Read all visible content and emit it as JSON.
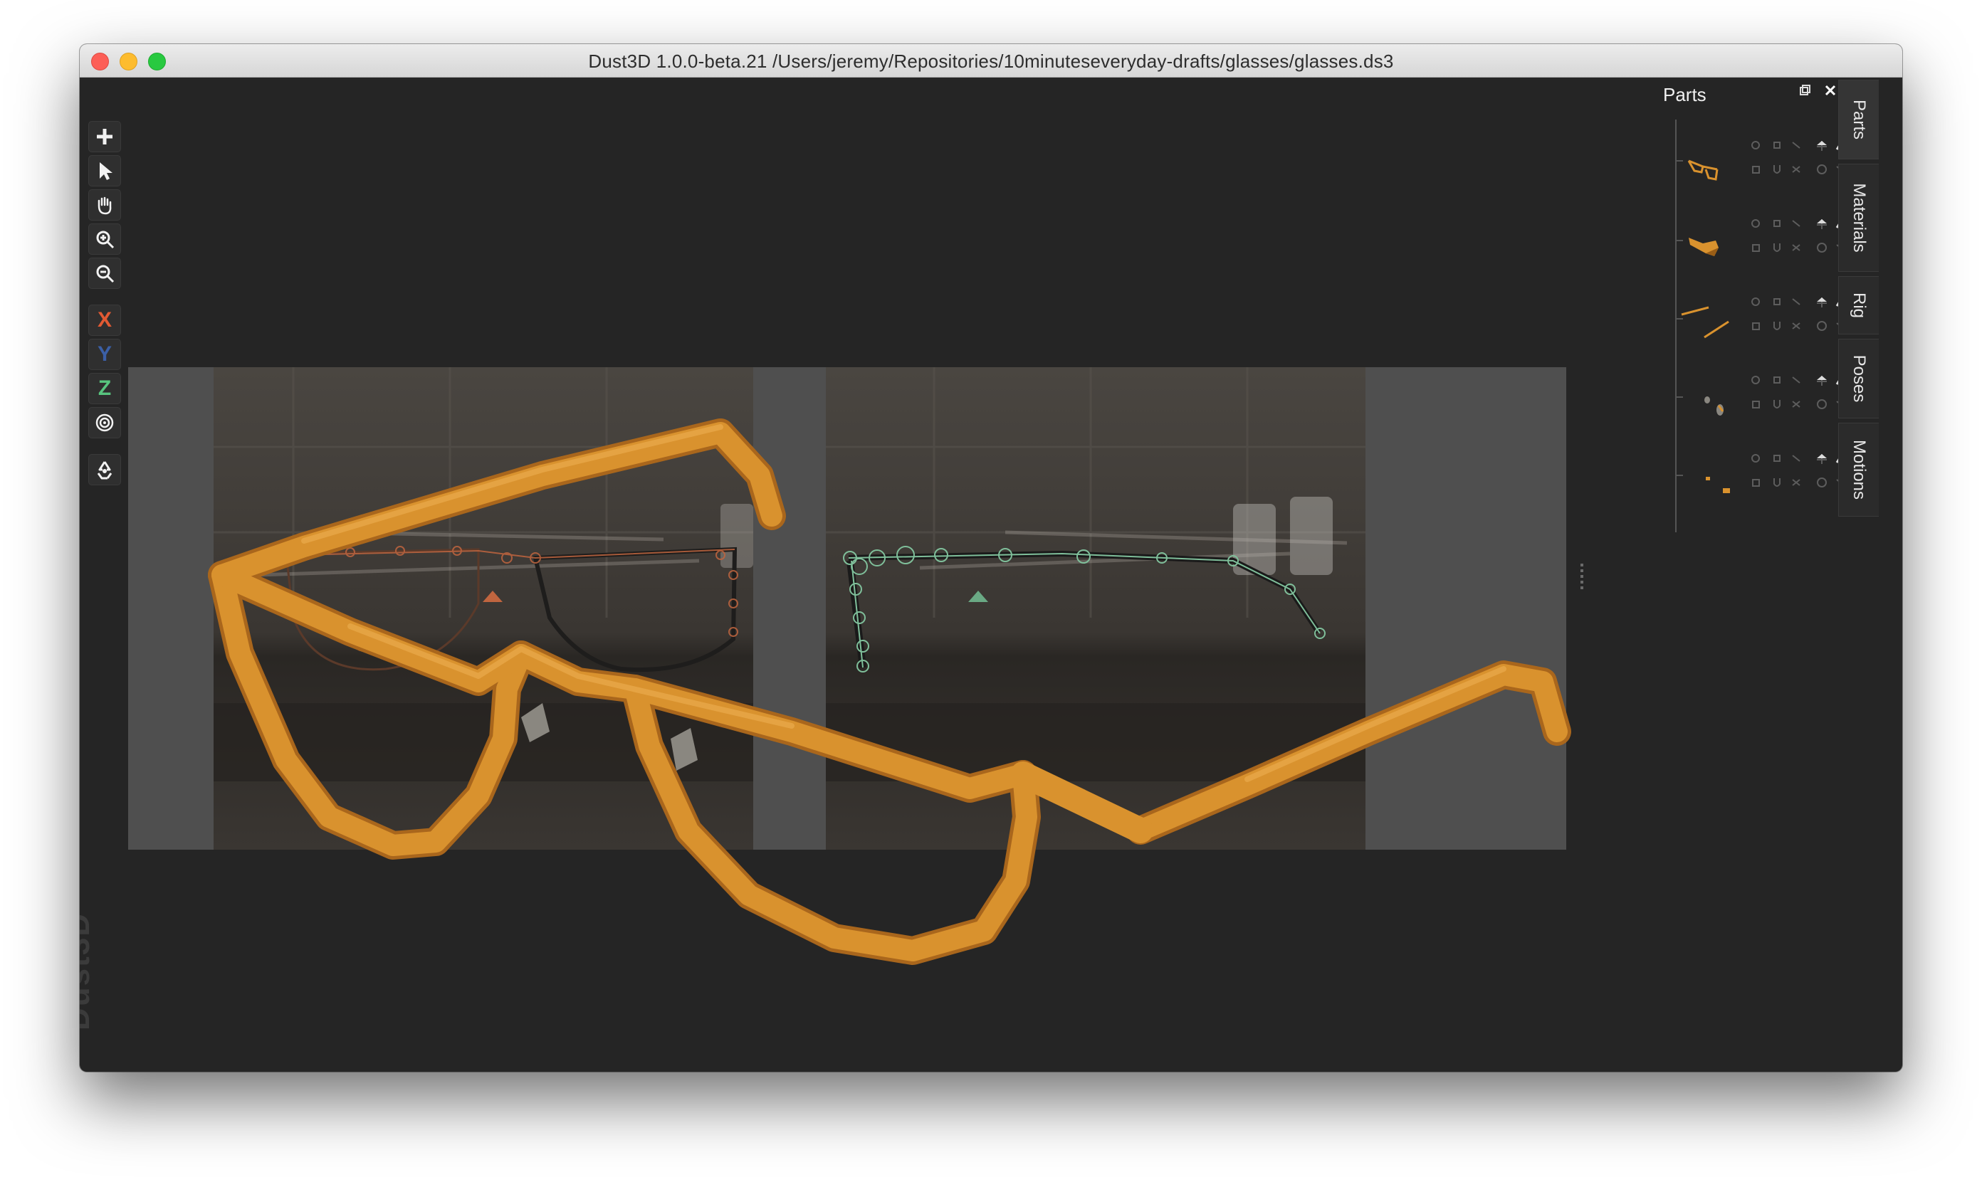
{
  "window": {
    "title": "Dust3D 1.0.0-beta.21 /Users/jeremy/Repositories/10minuteseveryday-drafts/glasses/glasses.ds3"
  },
  "toolbar": {
    "add_icon": "plus-icon",
    "select_icon": "pointer-icon",
    "pan_icon": "hand-icon",
    "zoom_in_icon": "zoom-in-icon",
    "zoom_out_icon": "zoom-out-icon",
    "x_label": "X",
    "y_label": "Y",
    "z_label": "Z",
    "radius_icon": "target-icon",
    "regenerate_icon": "recycle-icon"
  },
  "watermark": "Dust3D",
  "parts_panel": {
    "title": "Parts",
    "part_count": 5
  },
  "side_tabs": [
    "Parts",
    "Materials",
    "Rig",
    "Poses",
    "Motions"
  ],
  "colors": {
    "background": "#252525",
    "model_orange": "#d9922e",
    "x_axis": "#e25a33",
    "y_axis": "#3b5fa6",
    "z_axis": "#58c47e"
  }
}
